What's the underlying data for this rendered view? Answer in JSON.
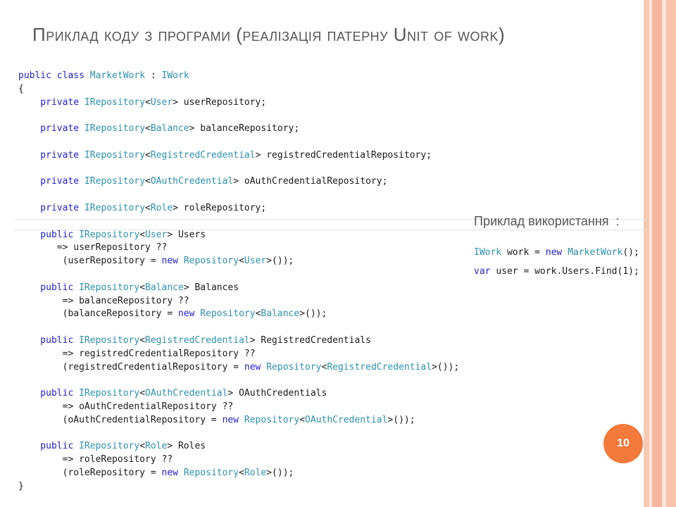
{
  "slide": {
    "title": "Приклад коду з програми (реалізація патерну Unit of work)",
    "page_number": "10",
    "usage_title": "Приклад використання  :",
    "accent_color": "#f47a3c"
  },
  "code_lines": [
    [
      {
        "t": "public class ",
        "c": "kw"
      },
      {
        "t": "MarketWork",
        "c": "ty"
      },
      {
        "t": " : ",
        "c": "plain"
      },
      {
        "t": "IWork",
        "c": "ty"
      }
    ],
    [
      {
        "t": "{",
        "c": "plain"
      }
    ],
    [
      {
        "t": "    private ",
        "c": "kw"
      },
      {
        "t": "IRepository",
        "c": "ty"
      },
      {
        "t": "<",
        "c": "plain"
      },
      {
        "t": "User",
        "c": "ty"
      },
      {
        "t": "> userRepository;",
        "c": "plain"
      }
    ],
    [],
    [
      {
        "t": "    private ",
        "c": "kw"
      },
      {
        "t": "IRepository",
        "c": "ty"
      },
      {
        "t": "<",
        "c": "plain"
      },
      {
        "t": "Balance",
        "c": "ty"
      },
      {
        "t": "> balanceRepository;",
        "c": "plain"
      }
    ],
    [],
    [
      {
        "t": "    private ",
        "c": "kw"
      },
      {
        "t": "IRepository",
        "c": "ty"
      },
      {
        "t": "<",
        "c": "plain"
      },
      {
        "t": "RegistredCredential",
        "c": "ty"
      },
      {
        "t": "> registredCredentialRepository;",
        "c": "plain"
      }
    ],
    [],
    [
      {
        "t": "    private ",
        "c": "kw"
      },
      {
        "t": "IRepository",
        "c": "ty"
      },
      {
        "t": "<",
        "c": "plain"
      },
      {
        "t": "OAuthCredential",
        "c": "ty"
      },
      {
        "t": "> oAuthCredentialRepository;",
        "c": "plain"
      }
    ],
    [],
    [
      {
        "t": "    private ",
        "c": "kw"
      },
      {
        "t": "IRepository",
        "c": "ty"
      },
      {
        "t": "<",
        "c": "plain"
      },
      {
        "t": "Role",
        "c": "ty"
      },
      {
        "t": "> roleRepository;",
        "c": "plain"
      }
    ],
    [],
    [
      {
        "t": "    public ",
        "c": "kw"
      },
      {
        "t": "IRepository",
        "c": "ty"
      },
      {
        "t": "<",
        "c": "plain"
      },
      {
        "t": "User",
        "c": "ty"
      },
      {
        "t": "> Users",
        "c": "plain"
      }
    ],
    [
      {
        "t": "       => userRepository ??",
        "c": "plain"
      }
    ],
    [
      {
        "t": "        (userRepository = ",
        "c": "plain"
      },
      {
        "t": "new ",
        "c": "kw"
      },
      {
        "t": "Repository",
        "c": "ty"
      },
      {
        "t": "<",
        "c": "plain"
      },
      {
        "t": "User",
        "c": "ty"
      },
      {
        "t": ">());",
        "c": "plain"
      }
    ],
    [],
    [
      {
        "t": "    public ",
        "c": "kw"
      },
      {
        "t": "IRepository",
        "c": "ty"
      },
      {
        "t": "<",
        "c": "plain"
      },
      {
        "t": "Balance",
        "c": "ty"
      },
      {
        "t": "> Balances",
        "c": "plain"
      }
    ],
    [
      {
        "t": "        => balanceRepository ??",
        "c": "plain"
      }
    ],
    [
      {
        "t": "        (balanceRepository = ",
        "c": "plain"
      },
      {
        "t": "new ",
        "c": "kw"
      },
      {
        "t": "Repository",
        "c": "ty"
      },
      {
        "t": "<",
        "c": "plain"
      },
      {
        "t": "Balance",
        "c": "ty"
      },
      {
        "t": ">());",
        "c": "plain"
      }
    ],
    [],
    [
      {
        "t": "    public ",
        "c": "kw"
      },
      {
        "t": "IRepository",
        "c": "ty"
      },
      {
        "t": "<",
        "c": "plain"
      },
      {
        "t": "RegistredCredential",
        "c": "ty"
      },
      {
        "t": "> RegistredCredentials",
        "c": "plain"
      }
    ],
    [
      {
        "t": "        => registredCredentialRepository ??",
        "c": "plain"
      }
    ],
    [
      {
        "t": "        (registredCredentialRepository = ",
        "c": "plain"
      },
      {
        "t": "new ",
        "c": "kw"
      },
      {
        "t": "Repository",
        "c": "ty"
      },
      {
        "t": "<",
        "c": "plain"
      },
      {
        "t": "RegistredCredential",
        "c": "ty"
      },
      {
        "t": ">());",
        "c": "plain"
      }
    ],
    [],
    [
      {
        "t": "    public ",
        "c": "kw"
      },
      {
        "t": "IRepository",
        "c": "ty"
      },
      {
        "t": "<",
        "c": "plain"
      },
      {
        "t": "OAuthCredential",
        "c": "ty"
      },
      {
        "t": "> OAuthCredentials",
        "c": "plain"
      }
    ],
    [
      {
        "t": "        => oAuthCredentialRepository ??",
        "c": "plain"
      }
    ],
    [
      {
        "t": "        (oAuthCredentialRepository = ",
        "c": "plain"
      },
      {
        "t": "new ",
        "c": "kw"
      },
      {
        "t": "Repository",
        "c": "ty"
      },
      {
        "t": "<",
        "c": "plain"
      },
      {
        "t": "OAuthCredential",
        "c": "ty"
      },
      {
        "t": ">());",
        "c": "plain"
      }
    ],
    [],
    [
      {
        "t": "    public ",
        "c": "kw"
      },
      {
        "t": "IRepository",
        "c": "ty"
      },
      {
        "t": "<",
        "c": "plain"
      },
      {
        "t": "Role",
        "c": "ty"
      },
      {
        "t": "> Roles",
        "c": "plain"
      }
    ],
    [
      {
        "t": "        => roleRepository ??",
        "c": "plain"
      }
    ],
    [
      {
        "t": "        (roleRepository = ",
        "c": "plain"
      },
      {
        "t": "new ",
        "c": "kw"
      },
      {
        "t": "Repository",
        "c": "ty"
      },
      {
        "t": "<",
        "c": "plain"
      },
      {
        "t": "Role",
        "c": "ty"
      },
      {
        "t": ">());",
        "c": "plain"
      }
    ],
    [
      {
        "t": "}",
        "c": "plain"
      }
    ]
  ],
  "usage_lines": [
    [
      {
        "t": "IWork",
        "c": "ty"
      },
      {
        "t": " work = ",
        "c": "plain"
      },
      {
        "t": "new ",
        "c": "kw"
      },
      {
        "t": "MarketWork",
        "c": "ty"
      },
      {
        "t": "();",
        "c": "plain"
      }
    ],
    [
      {
        "t": "var ",
        "c": "kw"
      },
      {
        "t": "user = work.Users.Find(1);",
        "c": "plain"
      }
    ]
  ]
}
